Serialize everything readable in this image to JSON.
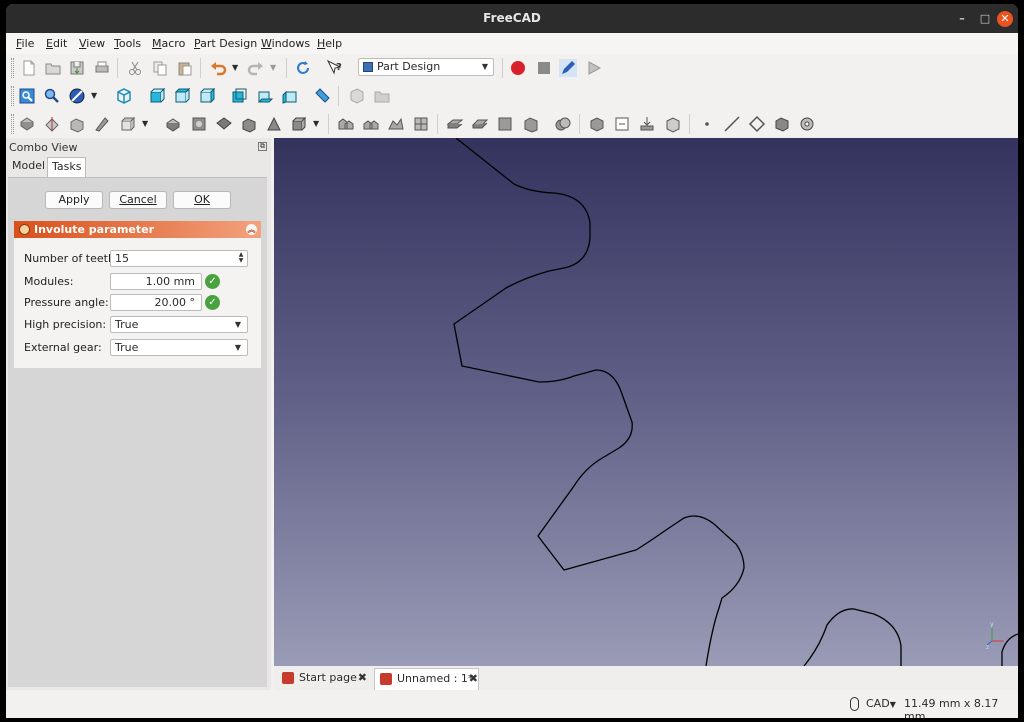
{
  "window": {
    "title": "FreeCAD",
    "controls": [
      "–",
      "□",
      "✕"
    ]
  },
  "menu": [
    {
      "label": "File",
      "u": "F",
      "rest": "ile"
    },
    {
      "label": "Edit",
      "u": "E",
      "rest": "dit"
    },
    {
      "label": "View",
      "u": "V",
      "rest": "iew"
    },
    {
      "label": "Tools",
      "u": "T",
      "rest": "ools"
    },
    {
      "label": "Macro",
      "u": "M",
      "rest": "acro"
    },
    {
      "label": "Part Design",
      "u": "P",
      "rest": "art Design"
    },
    {
      "label": "Windows",
      "u": "W",
      "rest": "indows"
    },
    {
      "label": "Help",
      "u": "H",
      "rest": "elp"
    }
  ],
  "workbench": {
    "selected": "Part Design",
    "icon": "part-design-workbench-icon"
  },
  "combo_view": {
    "title": "Combo View",
    "tabs": [
      "Model",
      "Tasks"
    ],
    "active_tab": "Tasks",
    "buttons": {
      "apply": "Apply",
      "cancel": "Cancel",
      "ok": "OK"
    },
    "panel": {
      "title": "Involute parameter",
      "fields": {
        "teeth_label": "Number of teeth:",
        "teeth_value": "15",
        "modules_label": "Modules:",
        "modules_value": "1.00 mm",
        "pressure_label": "Pressure angle:",
        "pressure_value": "20.00 °",
        "precision_label": "High precision:",
        "precision_value": "True",
        "external_label": "External gear:",
        "external_value": "True"
      }
    }
  },
  "document_tabs": [
    {
      "label": "Start page",
      "active": false
    },
    {
      "label": "Unnamed : 1*",
      "active": true
    }
  ],
  "statusbar": {
    "nav_style": "CAD",
    "dimensions": "11.49 mm x 8.17 mm"
  },
  "colors": {
    "accent": "#e95420",
    "panel_header": "#d9501a",
    "viewport_top": "#33335e",
    "viewport_bottom": "#9a9bb6",
    "gear_line": "#000000"
  },
  "icons": {
    "toolbar_file": [
      "new-file-icon",
      "open-file-icon",
      "save-icon",
      "print-icon",
      "cut-icon",
      "copy-icon",
      "paste-icon",
      "undo-icon",
      "redo-icon",
      "refresh-icon",
      "whats-this-icon"
    ],
    "toolbar_macro": [
      "record-macro-icon",
      "stop-macro-icon",
      "edit-macro-icon",
      "run-macro-icon"
    ],
    "toolbar_view": [
      "fit-all-icon",
      "fit-selection-icon",
      "draw-style-icon",
      "isometric-view-icon",
      "front-view-icon",
      "top-view-icon",
      "right-view-icon",
      "rear-view-icon",
      "bottom-view-icon",
      "left-view-icon",
      "measure-icon",
      "part-icon",
      "group-icon"
    ],
    "toolbar_partdesign": [
      "body-icon",
      "sketch-icon",
      "pad-icon",
      "revolution-icon",
      "additive-primitive-icon",
      "pocket-icon",
      "hole-icon",
      "groove-icon",
      "subtractive-primitive-icon",
      "mirrored-icon",
      "linear-pattern-icon",
      "polar-pattern-icon",
      "multi-transform-icon",
      "fillet-icon",
      "chamfer-icon",
      "draft-icon",
      "thickness-icon",
      "boolean-icon",
      "shape-binder-icon",
      "clone-icon",
      "sub-shape-binder-icon",
      "datum-point-icon",
      "datum-line-icon",
      "datum-plane-icon",
      "local-cs-icon",
      "involute-gear-icon"
    ]
  }
}
